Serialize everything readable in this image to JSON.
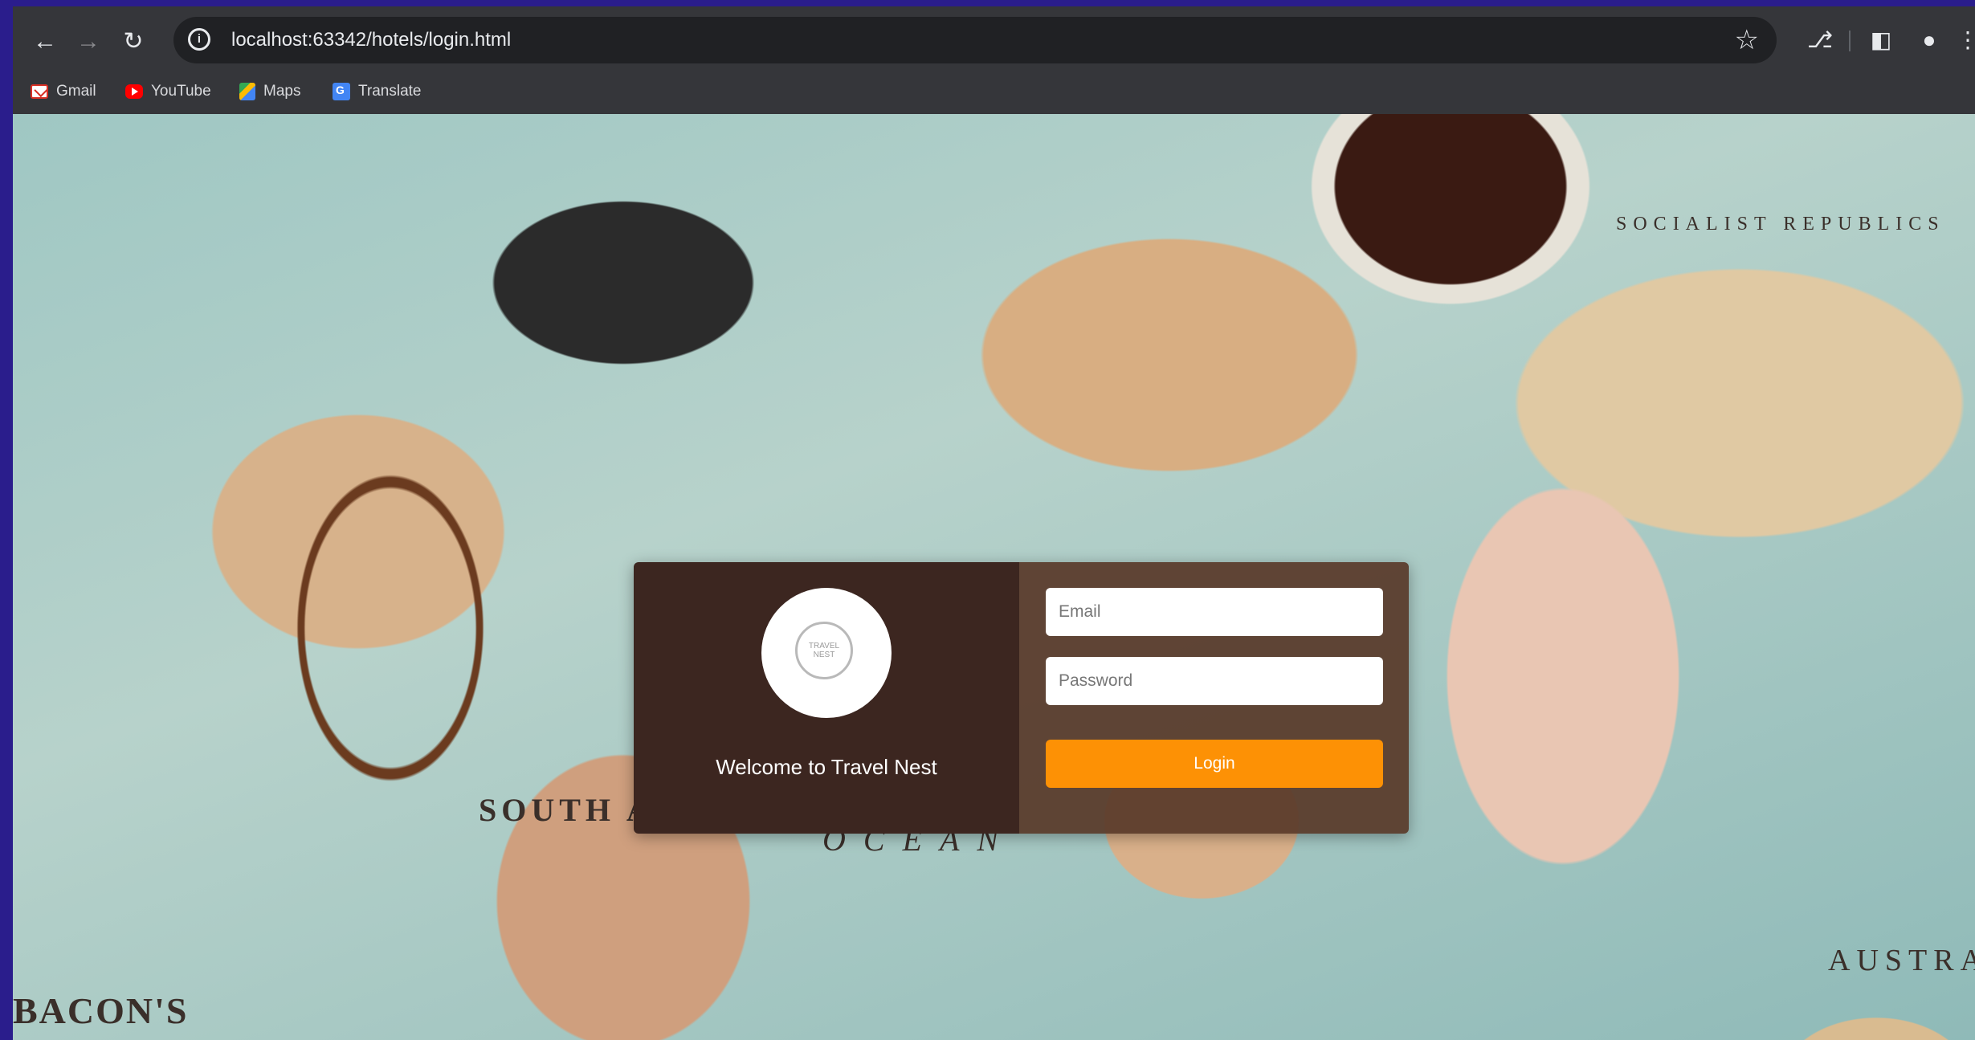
{
  "browser": {
    "url": "localhost:63342/hotels/login.html",
    "bookmarks": [
      {
        "label": "Gmail",
        "icon": "gmail-icon"
      },
      {
        "label": "YouTube",
        "icon": "youtube-icon"
      },
      {
        "label": "Maps",
        "icon": "maps-icon"
      },
      {
        "label": "Translate",
        "icon": "translate-icon"
      }
    ]
  },
  "background_map": {
    "labels": {
      "south_america": "SOUTH AMERICA",
      "ocean": "OCEAN",
      "bacons": "BACON'S",
      "austra": "AUSTRA",
      "socialist": "SOCIALIST REPUBLICS"
    }
  },
  "login": {
    "welcome": "Welcome to Travel Nest",
    "logo_text": "TRAVEL NEST",
    "email_placeholder": "Email",
    "password_placeholder": "Password",
    "button_label": "Login"
  },
  "colors": {
    "card_left": "#3c2620",
    "card_right": "#58382880",
    "login_button": "#fd9105",
    "chrome": "#35363a",
    "frame": "#2a1d8c"
  }
}
